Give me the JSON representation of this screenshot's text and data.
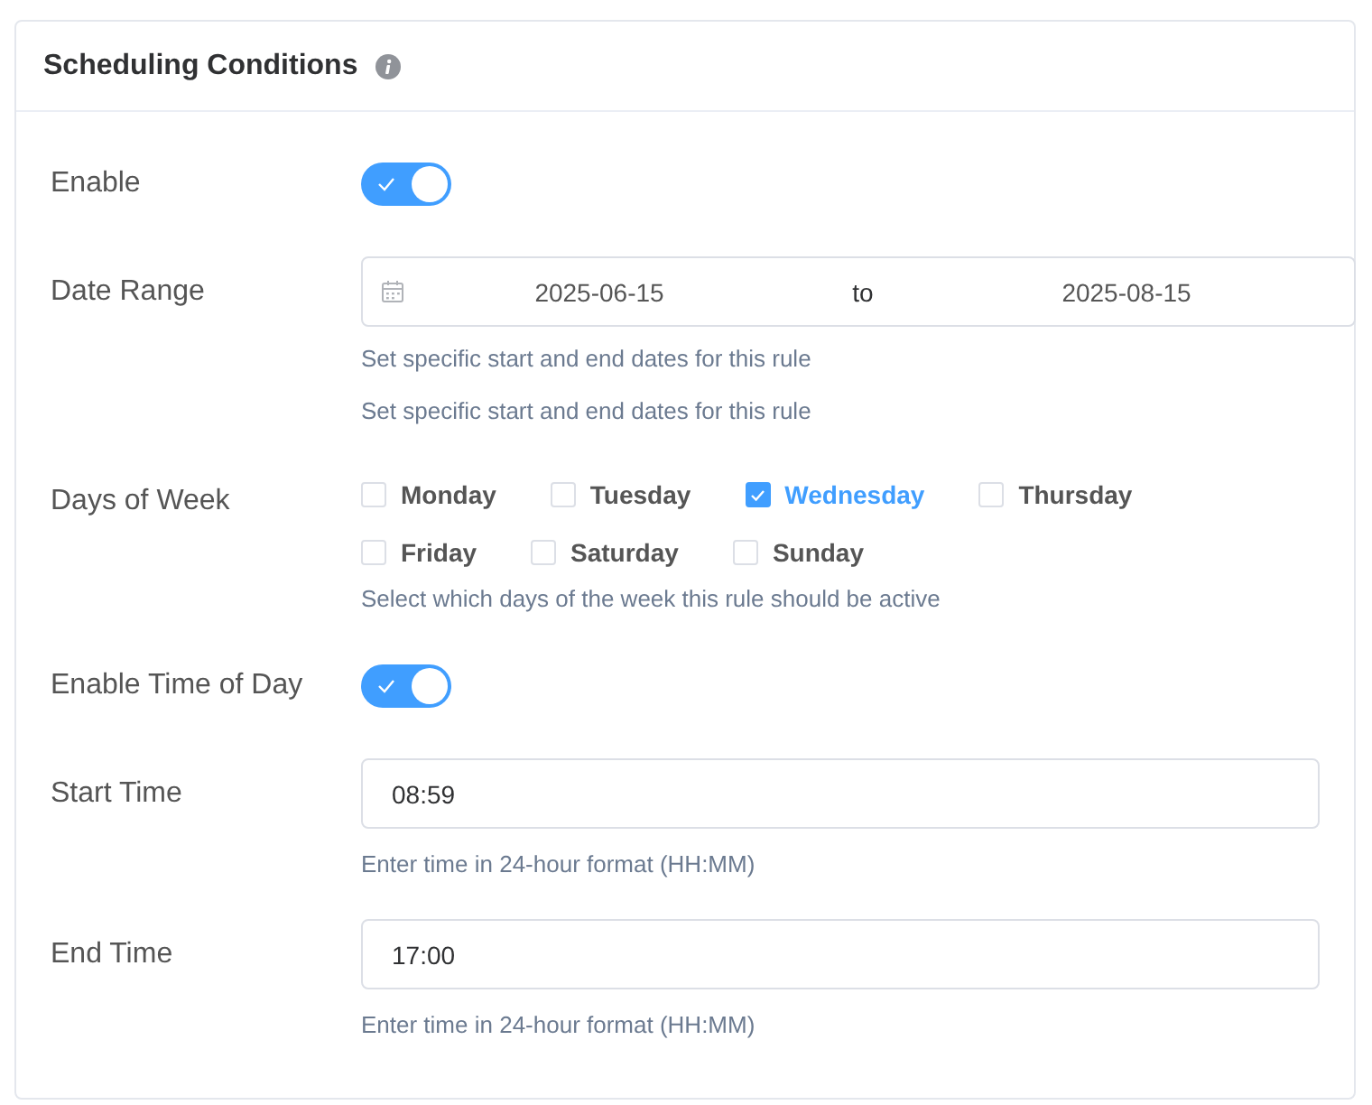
{
  "card": {
    "title": "Scheduling Conditions"
  },
  "rows": [
    {
      "kind": "toggle",
      "label": "Enable",
      "on": true
    },
    {
      "kind": "date_range",
      "label": "Date Range",
      "start": "2025-06-15",
      "separator": "to",
      "end": "2025-08-15",
      "hints": [
        "Set specific start and end dates for this rule",
        "Set specific start and end dates for this rule"
      ]
    },
    {
      "kind": "days",
      "label": "Days of Week",
      "days": [
        {
          "label": "Monday",
          "checked": false
        },
        {
          "label": "Tuesday",
          "checked": false
        },
        {
          "label": "Wednesday",
          "checked": true
        },
        {
          "label": "Thursday",
          "checked": false
        },
        {
          "label": "Friday",
          "checked": false
        },
        {
          "label": "Saturday",
          "checked": false
        },
        {
          "label": "Sunday",
          "checked": false
        }
      ],
      "hints": [
        "Select which days of the week this rule should be active"
      ]
    },
    {
      "kind": "toggle",
      "label": "Enable Time of Day",
      "on": true
    },
    {
      "kind": "time",
      "label": "Start Time",
      "value": "08:59",
      "hints": [
        "Enter time in 24-hour format (HH:MM)"
      ]
    },
    {
      "kind": "time",
      "label": "End Time",
      "value": "17:00",
      "hints": [
        "Enter time in 24-hour format (HH:MM)"
      ]
    }
  ]
}
